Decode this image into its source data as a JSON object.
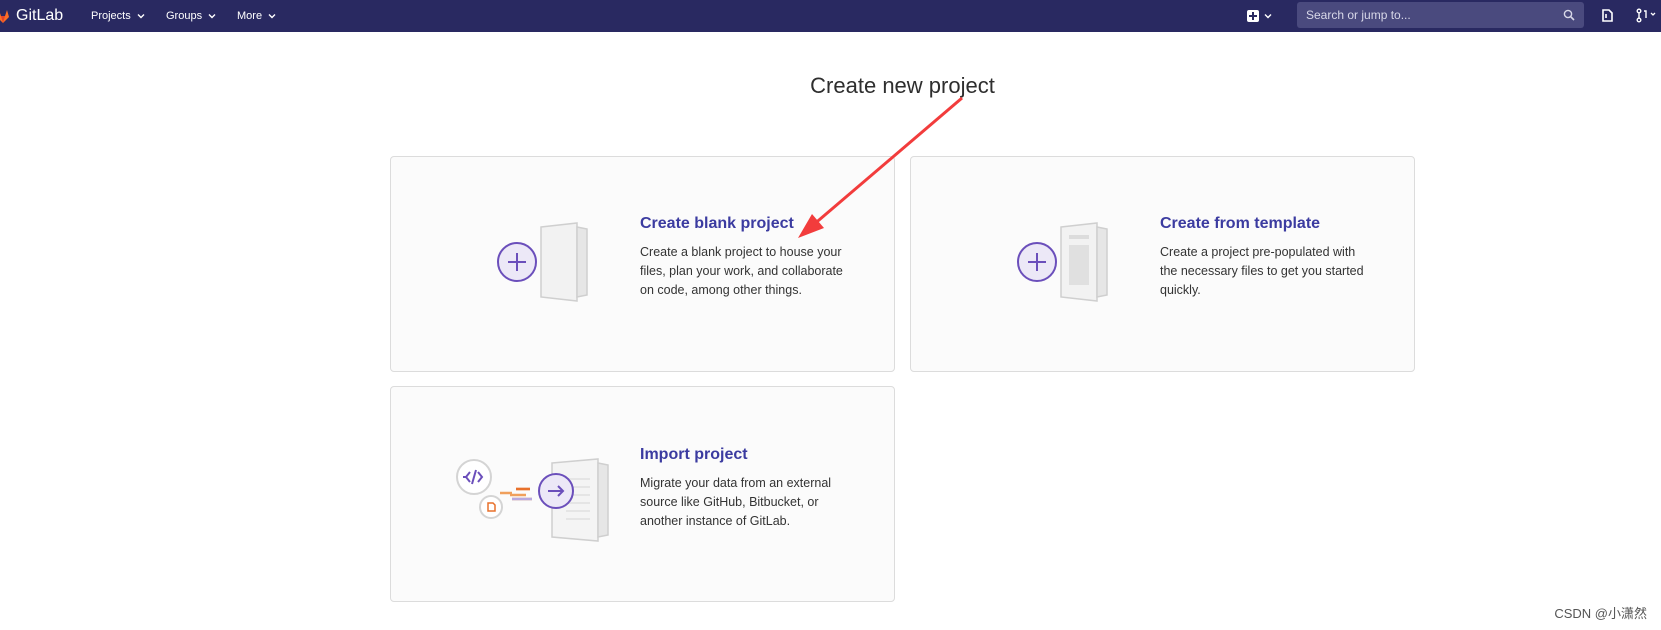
{
  "navbar": {
    "brand": "GitLab",
    "menu": [
      {
        "label": "Projects"
      },
      {
        "label": "Groups"
      },
      {
        "label": "More"
      }
    ],
    "search_placeholder": "Search or jump to..."
  },
  "page_title": "Create new project",
  "cards": [
    {
      "heading": "Create blank project",
      "description": "Create a blank project to house your files, plan your work, and collaborate on code, among other things."
    },
    {
      "heading": "Create from template",
      "description": "Create a project pre-populated with the necessary files to get you started quickly."
    },
    {
      "heading": "Import project",
      "description": "Migrate your data from an external source like GitHub, Bitbucket, or another instance of GitLab."
    }
  ],
  "watermark": "CSDN @小潇然",
  "colors": {
    "navbar_bg": "#292961",
    "link_purple": "#3b3ba0",
    "accent_purple": "#6b4fbb",
    "annotation_arrow": "#f23c3c"
  },
  "icons": [
    "gitlab-logo",
    "chevron-down-icon",
    "plus-square-icon",
    "search-icon",
    "todo-icon",
    "merge-request-icon"
  ]
}
